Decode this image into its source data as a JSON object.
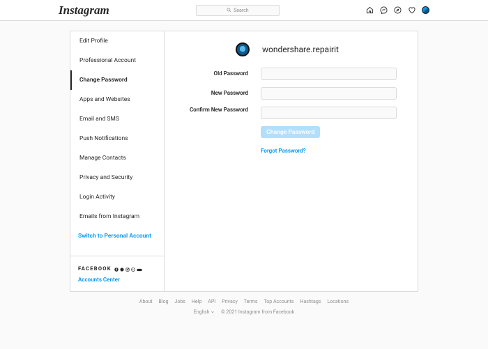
{
  "header": {
    "logo": "Instagram",
    "search_placeholder": "Search"
  },
  "sidebar": {
    "items": [
      {
        "label": "Edit Profile"
      },
      {
        "label": "Professional Account"
      },
      {
        "label": "Change Password"
      },
      {
        "label": "Apps and Websites"
      },
      {
        "label": "Email and SMS"
      },
      {
        "label": "Push Notifications"
      },
      {
        "label": "Manage Contacts"
      },
      {
        "label": "Privacy and Security"
      },
      {
        "label": "Login Activity"
      },
      {
        "label": "Emails from Instagram"
      }
    ],
    "switch_link": "Switch to Personal Account",
    "facebook_label": "FACEBOOK",
    "accounts_center": "Accounts Center"
  },
  "main": {
    "username": "wondershare.repairit",
    "fields": {
      "old_password_label": "Old Password",
      "new_password_label": "New Password",
      "confirm_label": "Confirm New Password"
    },
    "submit_label": "Change Password",
    "forgot_label": "Forgot Password?"
  },
  "footer": {
    "links": [
      "About",
      "Blog",
      "Jobs",
      "Help",
      "API",
      "Privacy",
      "Terms",
      "Top Accounts",
      "Hashtags",
      "Locations"
    ],
    "language": "English",
    "copyright": "© 2021 Instagram from Facebook"
  }
}
